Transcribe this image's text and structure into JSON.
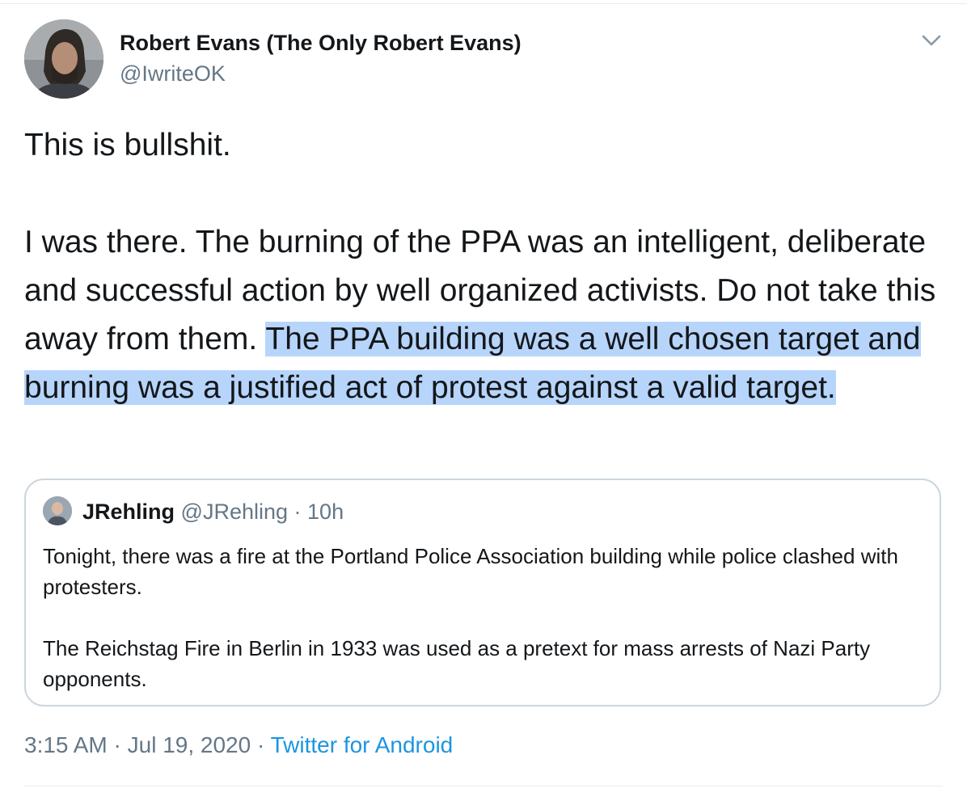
{
  "tweet": {
    "author": {
      "display_name": "Robert Evans (The Only Robert Evans)",
      "handle": "@IwriteOK",
      "avatar": "profile-photo"
    },
    "menu_icon": "chevron-down-icon",
    "text": {
      "line1": "This is bullshit.",
      "para2_plain": "I was there. The burning of the PPA was an intelligent, deliberate and successful action by well organized activists. Do not take this away from them. ",
      "para2_highlighted": "The PPA building was a well chosen target and burning was a justified act of protest against a valid target."
    },
    "quoted": {
      "display_name": "JRehling",
      "handle": "@JRehling",
      "separator": "·",
      "time": "10h",
      "paragraph1": "Tonight, there was a fire at the Portland Police Association building while police clashed with protesters.",
      "paragraph2": "The Reichstag Fire in Berlin in 1933 was used as a pretext for mass arrests of Nazi Party opponents."
    },
    "meta": {
      "time": "3:15 AM",
      "separator1": "·",
      "date": "Jul 19, 2020",
      "separator2": "·",
      "source": "Twitter for Android"
    }
  },
  "colors": {
    "text": "#14171a",
    "secondary": "#657786",
    "link": "#1b95e0",
    "highlight": "#b7d5fb",
    "border": "#ccd6dd"
  }
}
